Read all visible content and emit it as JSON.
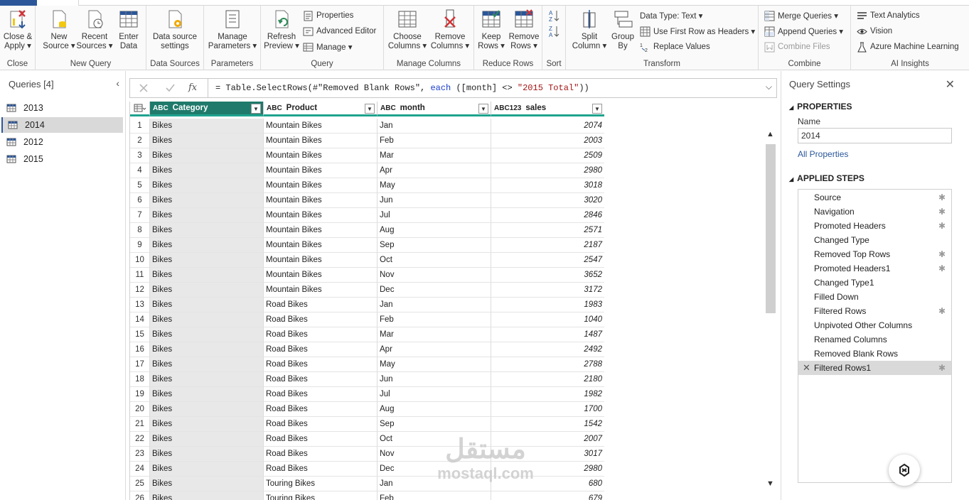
{
  "ribbon": {
    "groups": {
      "close": "Close",
      "new_query": "New Query",
      "data_sources": "Data Sources",
      "parameters": "Parameters",
      "query": "Query",
      "manage_columns": "Manage Columns",
      "reduce_rows": "Reduce Rows",
      "sort": "Sort",
      "transform": "Transform",
      "combine": "Combine",
      "ai_insights": "AI Insights"
    },
    "close_apply": [
      "Close &",
      "Apply ▾"
    ],
    "new_source": [
      "New",
      "Source ▾"
    ],
    "recent_sources": [
      "Recent",
      "Sources ▾"
    ],
    "enter_data": [
      "Enter",
      "Data"
    ],
    "data_source_settings": [
      "Data source",
      "settings"
    ],
    "manage_parameters": [
      "Manage",
      "Parameters ▾"
    ],
    "refresh_preview": [
      "Refresh",
      "Preview ▾"
    ],
    "properties": "Properties",
    "advanced_editor": "Advanced Editor",
    "manage": "Manage ▾",
    "choose_columns": [
      "Choose",
      "Columns ▾"
    ],
    "remove_columns": [
      "Remove",
      "Columns ▾"
    ],
    "keep_rows": [
      "Keep",
      "Rows ▾"
    ],
    "remove_rows": [
      "Remove",
      "Rows ▾"
    ],
    "split_column": [
      "Split",
      "Column ▾"
    ],
    "group_by": [
      "Group",
      "By"
    ],
    "data_type": "Data Type: Text ▾",
    "use_first_row": "Use First Row as Headers ▾",
    "replace_values": "Replace Values",
    "merge_queries": "Merge Queries ▾",
    "append_queries": "Append Queries ▾",
    "combine_files": "Combine Files",
    "text_analytics": "Text Analytics",
    "vision": "Vision",
    "azure_ml": "Azure Machine Learning"
  },
  "queries": {
    "title": "Queries [4]",
    "items": [
      "2013",
      "2014",
      "2012",
      "2015"
    ],
    "selected": "2014"
  },
  "formula": {
    "prefix": "= Table.SelectRows(#\"Removed Blank Rows\", ",
    "kw": "each",
    "mid": " ([month] <> ",
    "str": "\"2015 Total\"",
    "suffix": "))"
  },
  "columns": [
    {
      "type": "ABC",
      "name": "Category"
    },
    {
      "type": "ABC",
      "name": "Product"
    },
    {
      "type": "ABC",
      "name": "month"
    },
    {
      "type": "ABC123",
      "name": "sales"
    }
  ],
  "rows": [
    [
      "1",
      "Bikes",
      "Mountain Bikes",
      "Jan",
      "2074"
    ],
    [
      "2",
      "Bikes",
      "Mountain Bikes",
      "Feb",
      "2003"
    ],
    [
      "3",
      "Bikes",
      "Mountain Bikes",
      "Mar",
      "2509"
    ],
    [
      "4",
      "Bikes",
      "Mountain Bikes",
      "Apr",
      "2980"
    ],
    [
      "5",
      "Bikes",
      "Mountain Bikes",
      "May",
      "3018"
    ],
    [
      "6",
      "Bikes",
      "Mountain Bikes",
      "Jun",
      "3020"
    ],
    [
      "7",
      "Bikes",
      "Mountain Bikes",
      "Jul",
      "2846"
    ],
    [
      "8",
      "Bikes",
      "Mountain Bikes",
      "Aug",
      "2571"
    ],
    [
      "9",
      "Bikes",
      "Mountain Bikes",
      "Sep",
      "2187"
    ],
    [
      "10",
      "Bikes",
      "Mountain Bikes",
      "Oct",
      "2547"
    ],
    [
      "11",
      "Bikes",
      "Mountain Bikes",
      "Nov",
      "3652"
    ],
    [
      "12",
      "Bikes",
      "Mountain Bikes",
      "Dec",
      "3172"
    ],
    [
      "13",
      "Bikes",
      "Road Bikes",
      "Jan",
      "1983"
    ],
    [
      "14",
      "Bikes",
      "Road Bikes",
      "Feb",
      "1040"
    ],
    [
      "15",
      "Bikes",
      "Road Bikes",
      "Mar",
      "1487"
    ],
    [
      "16",
      "Bikes",
      "Road Bikes",
      "Apr",
      "2492"
    ],
    [
      "17",
      "Bikes",
      "Road Bikes",
      "May",
      "2788"
    ],
    [
      "18",
      "Bikes",
      "Road Bikes",
      "Jun",
      "2180"
    ],
    [
      "19",
      "Bikes",
      "Road Bikes",
      "Jul",
      "1982"
    ],
    [
      "20",
      "Bikes",
      "Road Bikes",
      "Aug",
      "1700"
    ],
    [
      "21",
      "Bikes",
      "Road Bikes",
      "Sep",
      "1542"
    ],
    [
      "22",
      "Bikes",
      "Road Bikes",
      "Oct",
      "2007"
    ],
    [
      "23",
      "Bikes",
      "Road Bikes",
      "Nov",
      "3017"
    ],
    [
      "24",
      "Bikes",
      "Road Bikes",
      "Dec",
      "2980"
    ],
    [
      "25",
      "Bikes",
      "Touring Bikes",
      "Jan",
      "680"
    ],
    [
      "26",
      "Bikes",
      "Touring Bikes",
      "Feb",
      "679"
    ]
  ],
  "query_settings": {
    "title": "Query Settings",
    "properties_label": "PROPERTIES",
    "name_label": "Name",
    "name_value": "2014",
    "all_properties": "All Properties",
    "applied_steps_label": "APPLIED STEPS",
    "steps": [
      {
        "name": "Source",
        "gear": true
      },
      {
        "name": "Navigation",
        "gear": true
      },
      {
        "name": "Promoted Headers",
        "gear": true
      },
      {
        "name": "Changed Type",
        "gear": false
      },
      {
        "name": "Removed Top Rows",
        "gear": true
      },
      {
        "name": "Promoted Headers1",
        "gear": true
      },
      {
        "name": "Changed Type1",
        "gear": false
      },
      {
        "name": "Filled Down",
        "gear": false
      },
      {
        "name": "Filtered Rows",
        "gear": true
      },
      {
        "name": "Unpivoted Other Columns",
        "gear": false
      },
      {
        "name": "Renamed Columns",
        "gear": false
      },
      {
        "name": "Removed Blank Rows",
        "gear": false
      },
      {
        "name": "Filtered Rows1",
        "gear": true
      }
    ],
    "selected_step": "Filtered Rows1"
  },
  "watermark": {
    "ar": "مستقل",
    "en": "mostaql.com"
  },
  "colors": {
    "accent": "#2b579a",
    "header_selected": "#1f7a6b",
    "header_underline": "#1fa38e"
  }
}
